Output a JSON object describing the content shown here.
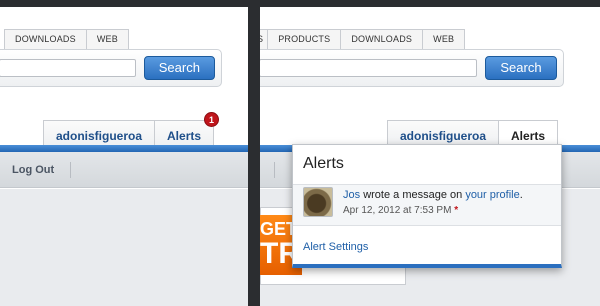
{
  "left_panel": {
    "scope_tabs": [
      "DOWNLOADS",
      "WEB"
    ],
    "search_button": "Search",
    "user_tab": "adonisfigueroa",
    "alerts_tab": "Alerts",
    "alerts_badge": "1",
    "nav": {
      "logout": "Log Out"
    }
  },
  "right_panel": {
    "scope_tabs": [
      "S",
      "PRODUCTS",
      "DOWNLOADS",
      "WEB"
    ],
    "search_button": "Search",
    "user_tab": "adonisfigueroa",
    "alerts_tab": "Alerts",
    "promo": {
      "line1": "GET",
      "line2": "TR"
    },
    "popover": {
      "title": "Alerts",
      "alert": {
        "user": "Jos",
        "message": "wrote a message on",
        "target": "your profile",
        "end": ".",
        "time": "Apr 12, 2012 at 7:53 PM",
        "new_marker": "*"
      },
      "settings_link": "Alert Settings"
    }
  },
  "colors": {
    "accent_blue": "#2b6fbf",
    "badge_red": "#c0151b",
    "link_blue": "#2060a8"
  }
}
